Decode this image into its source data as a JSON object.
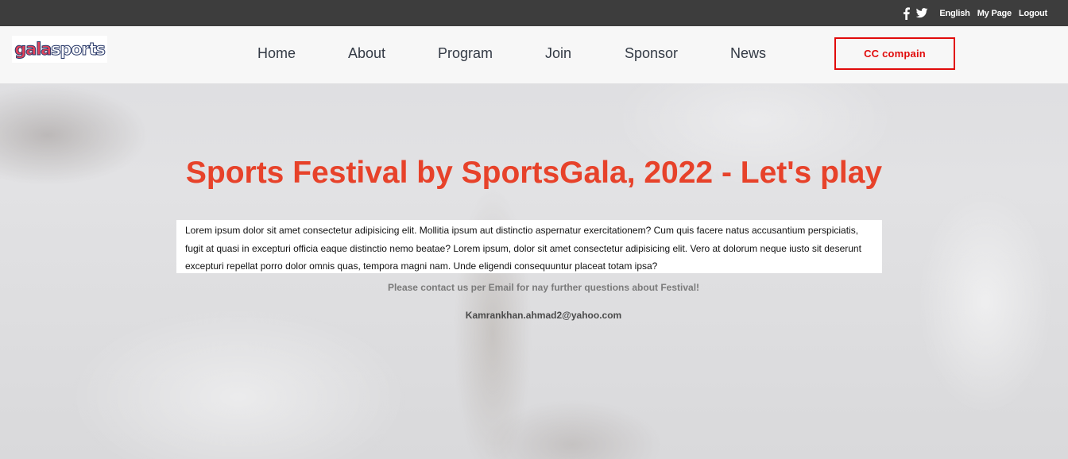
{
  "topbar": {
    "social_icons": [
      "facebook-icon",
      "twitter-icon"
    ],
    "links": {
      "english": "English",
      "my_page": "My Page",
      "logout": "Logout"
    }
  },
  "logo": {
    "part1": "gala",
    "part2": "sports"
  },
  "nav": {
    "home": "Home",
    "about": "About",
    "program": "Program",
    "join": "Join",
    "sponsor": "Sponsor",
    "news": "News",
    "cta": "CC compain"
  },
  "hero": {
    "title": "Sports Festival by SportsGala, 2022 - Let's play",
    "body": "Lorem ipsum dolor sit amet consectetur adipisicing elit. Mollitia ipsum aut distinctio aspernatur exercitationem? Cum quis facere natus accusantium perspiciatis, fugit at quasi in excepturi officia eaque distinctio nemo beatae? Lorem ipsum, dolor sit amet consectetur adipisicing elit. Vero at dolorum neque iusto sit deserunt excepturi repellat porro dolor omnis quas, tempora magni nam. Unde eligendi consequuntur placeat totam ipsa?",
    "contact_note": "Please contact us per Email for nay further questions about Festival!",
    "email": "Kamrankhan.ahmad2@yahoo.com"
  },
  "colors": {
    "topbar": "#3d3d3d",
    "title": "#e7422a",
    "cta_border": "#e10b0b",
    "nav_text": "#333a45"
  }
}
